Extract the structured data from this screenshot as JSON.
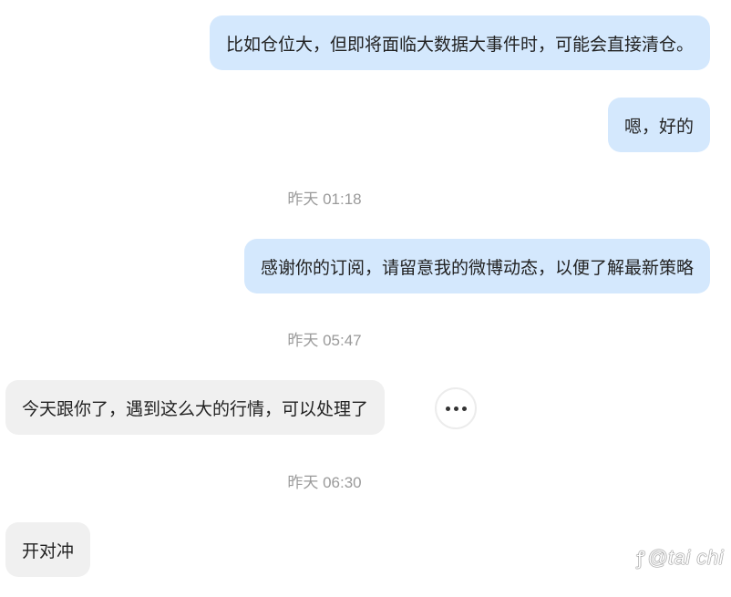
{
  "messages": [
    {
      "direction": "out",
      "text": "比如仓位大，但即将面临大数据大事件时，可能会直接清仓。"
    },
    {
      "direction": "out",
      "text": "嗯，好的"
    },
    {
      "direction": "time",
      "text": "昨天 01:18"
    },
    {
      "direction": "out",
      "text": "感谢你的订阅，请留意我的微博动态，以便了解最新策略"
    },
    {
      "direction": "time",
      "text": "昨天 05:47"
    },
    {
      "direction": "in",
      "text": "今天跟你了，遇到这么大的行情，可以处理了"
    },
    {
      "direction": "time",
      "text": "昨天 06:30"
    },
    {
      "direction": "in",
      "text": "开对冲"
    }
  ],
  "more_button": {
    "icon": "more-horizontal-icon"
  },
  "watermark": {
    "logo": "zhihu-logo",
    "text": "@tai chi"
  },
  "colors": {
    "outgoing_bubble": "#d4e8fd",
    "incoming_bubble": "#f0f0f0",
    "timestamp": "#9a9a9a",
    "text": "#222222"
  }
}
